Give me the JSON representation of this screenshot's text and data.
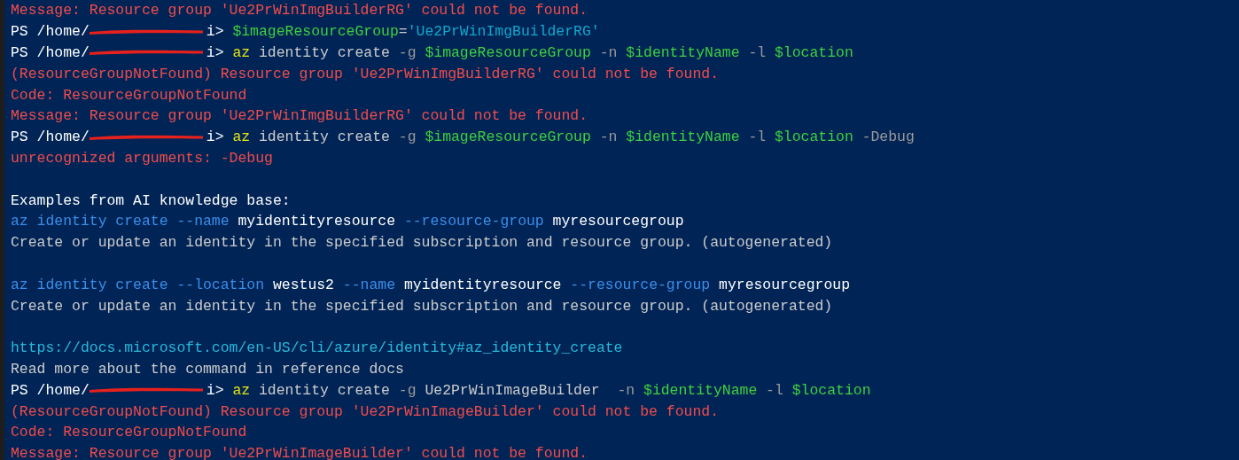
{
  "terminal": {
    "lines": [
      {
        "kind": "output",
        "segments": [
          {
            "kind": "error",
            "text": "Message: Resource group 'Ue2PrWinImgBuilderRG' could not be found."
          }
        ]
      },
      {
        "kind": "prompt",
        "prompt": "PS /home/",
        "prompt_end": "i>",
        "segments": [
          {
            "kind": "variable",
            "text": "$imageResourceGroup"
          },
          {
            "kind": "plain",
            "text": "="
          },
          {
            "kind": "string",
            "text": "'Ue2PrWinImgBuilderRG'"
          }
        ]
      },
      {
        "kind": "prompt",
        "prompt": "PS /home/",
        "prompt_end": "i>",
        "segments": [
          {
            "kind": "command",
            "text": "az"
          },
          {
            "kind": "plain",
            "text": " identity create "
          },
          {
            "kind": "flag",
            "text": "-g "
          },
          {
            "kind": "variable",
            "text": "$imageResourceGroup"
          },
          {
            "kind": "flag",
            "text": " -n "
          },
          {
            "kind": "variable",
            "text": "$identityName"
          },
          {
            "kind": "flag",
            "text": " -l "
          },
          {
            "kind": "variable",
            "text": "$location"
          }
        ]
      },
      {
        "kind": "output",
        "segments": [
          {
            "kind": "error",
            "text": "(ResourceGroupNotFound) Resource group 'Ue2PrWinImgBuilderRG' could not be found."
          }
        ]
      },
      {
        "kind": "output",
        "segments": [
          {
            "kind": "error",
            "text": "Code: ResourceGroupNotFound"
          }
        ]
      },
      {
        "kind": "output",
        "segments": [
          {
            "kind": "error",
            "text": "Message: Resource group 'Ue2PrWinImgBuilderRG' could not be found."
          }
        ]
      },
      {
        "kind": "prompt",
        "prompt": "PS /home/",
        "prompt_end": "i>",
        "segments": [
          {
            "kind": "command",
            "text": "az"
          },
          {
            "kind": "plain",
            "text": " identity create "
          },
          {
            "kind": "flag",
            "text": "-g "
          },
          {
            "kind": "variable",
            "text": "$imageResourceGroup"
          },
          {
            "kind": "flag",
            "text": " -n "
          },
          {
            "kind": "variable",
            "text": "$identityName"
          },
          {
            "kind": "flag",
            "text": " -l "
          },
          {
            "kind": "variable",
            "text": "$location"
          },
          {
            "kind": "flag",
            "text": " -Debug"
          }
        ]
      },
      {
        "kind": "output",
        "segments": [
          {
            "kind": "error",
            "text": "unrecognized arguments: -Debug"
          }
        ]
      },
      {
        "kind": "blank"
      },
      {
        "kind": "output",
        "segments": [
          {
            "kind": "bright",
            "text": "Examples from AI knowledge base:"
          }
        ]
      },
      {
        "kind": "output",
        "segments": [
          {
            "kind": "example",
            "text": "az identity create --name "
          },
          {
            "kind": "bright",
            "text": "myidentityresource"
          },
          {
            "kind": "example",
            "text": " --resource-group "
          },
          {
            "kind": "bright",
            "text": "myresourcegroup"
          }
        ]
      },
      {
        "kind": "output",
        "segments": [
          {
            "kind": "plain",
            "text": "Create or update an identity in the specified subscription and resource group. (autogenerated)"
          }
        ]
      },
      {
        "kind": "blank"
      },
      {
        "kind": "output",
        "segments": [
          {
            "kind": "example",
            "text": "az identity create --location "
          },
          {
            "kind": "bright",
            "text": "westus2"
          },
          {
            "kind": "example",
            "text": " --name "
          },
          {
            "kind": "bright",
            "text": "myidentityresource"
          },
          {
            "kind": "example",
            "text": " --resource-group "
          },
          {
            "kind": "bright",
            "text": "myresourcegroup"
          }
        ]
      },
      {
        "kind": "output",
        "segments": [
          {
            "kind": "plain",
            "text": "Create or update an identity in the specified subscription and resource group. (autogenerated)"
          }
        ]
      },
      {
        "kind": "blank"
      },
      {
        "kind": "output",
        "segments": [
          {
            "kind": "link",
            "text": "https://docs.microsoft.com/en-US/cli/azure/identity#az_identity_create"
          }
        ]
      },
      {
        "kind": "output",
        "segments": [
          {
            "kind": "plain",
            "text": "Read more about the command in reference docs"
          }
        ]
      },
      {
        "kind": "prompt",
        "prompt": "PS /home/",
        "prompt_end": "i>",
        "segments": [
          {
            "kind": "command",
            "text": "az"
          },
          {
            "kind": "plain",
            "text": " identity create "
          },
          {
            "kind": "flag",
            "text": "-g"
          },
          {
            "kind": "plain",
            "text": " Ue2PrWinImageBuilder  "
          },
          {
            "kind": "flag",
            "text": "-n "
          },
          {
            "kind": "variable",
            "text": "$identityName"
          },
          {
            "kind": "flag",
            "text": " -l "
          },
          {
            "kind": "variable",
            "text": "$location"
          }
        ]
      },
      {
        "kind": "output",
        "segments": [
          {
            "kind": "error",
            "text": "(ResourceGroupNotFound) Resource group 'Ue2PrWinImageBuilder' could not be found."
          }
        ]
      },
      {
        "kind": "output",
        "segments": [
          {
            "kind": "error",
            "text": "Code: ResourceGroupNotFound"
          }
        ]
      },
      {
        "kind": "output",
        "segments": [
          {
            "kind": "error",
            "text": "Message: Resource group 'Ue2PrWinImageBuilder' could not be found."
          }
        ]
      }
    ]
  }
}
